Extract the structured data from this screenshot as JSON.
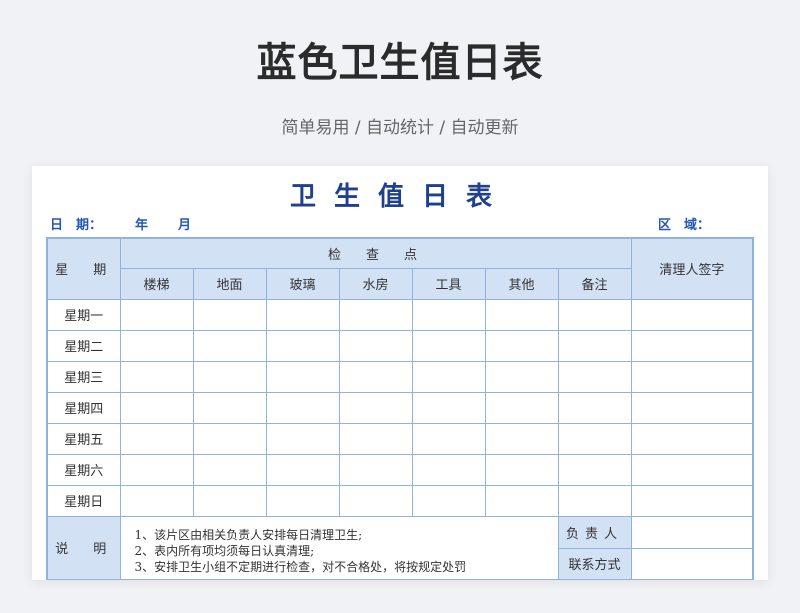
{
  "page": {
    "title": "蓝色卫生值日表",
    "subtitle": "简单易用 / 自动统计 / 自动更新"
  },
  "sheet": {
    "title": "卫生值日表",
    "meta": {
      "date_label": "日　期：",
      "year_label": "年",
      "month_label": "月",
      "area_label": "区　域："
    },
    "table": {
      "weekday_header": "星　期",
      "check_header": "检　查　点",
      "signature_header": "清理人签字",
      "columns": [
        "楼梯",
        "地面",
        "玻璃",
        "水房",
        "工具",
        "其他",
        "备注"
      ],
      "rows": [
        "星期一",
        "星期二",
        "星期三",
        "星期四",
        "星期五",
        "星期六",
        "星期日"
      ]
    },
    "notes": {
      "label": "说　明",
      "lines": [
        "1、该片区由相关负责人安排每日清理卫生;",
        "2、表内所有项均须每日认真清理;",
        "3、安排卫生小组不定期进行检查，对不合格处，将按规定处罚"
      ],
      "responsible_label": "负责人",
      "contact_label": "联系方式"
    }
  },
  "colors": {
    "accent": "#1f3f8f",
    "header_bg": "#d3e1f5",
    "border": "#8fb2de",
    "meta_text": "#2457b3"
  }
}
